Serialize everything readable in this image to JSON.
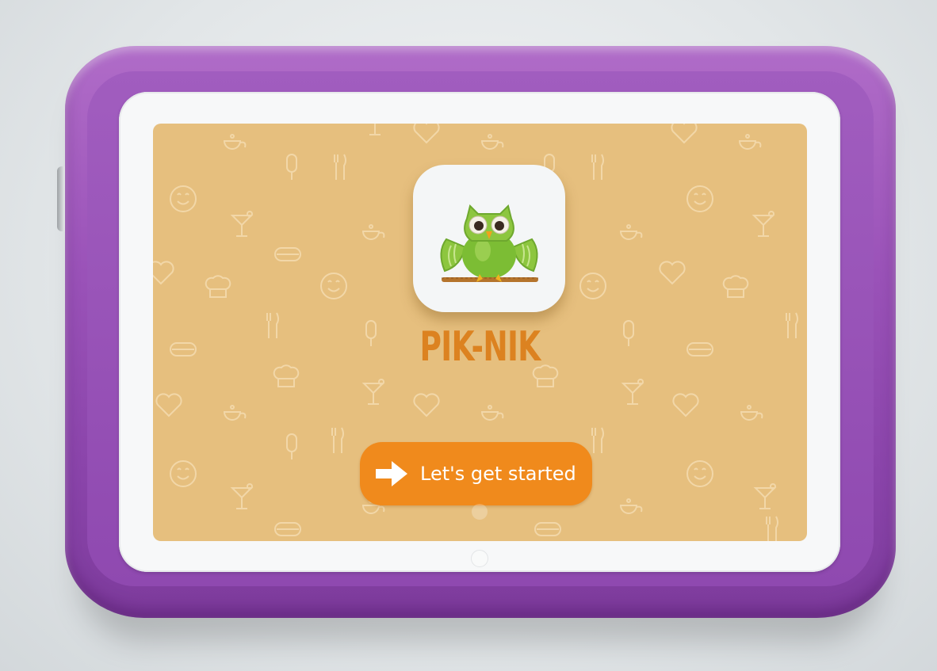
{
  "app": {
    "name": "PIK-NIK"
  },
  "start_button": {
    "label": "Let's get started",
    "icon": "arrow-right-icon"
  },
  "colors": {
    "screen_background": "#e6bf7e",
    "title": "#dc8220",
    "button": "#f08a1c",
    "device_bumper": "#9a52b8"
  },
  "pattern_icons": [
    "teapot-icon",
    "fork-knife-icon",
    "smiley-icon",
    "cocktail-icon",
    "heart-icon",
    "popsicle-icon",
    "chef-hat-icon",
    "sandwich-icon",
    "cup-icon"
  ]
}
